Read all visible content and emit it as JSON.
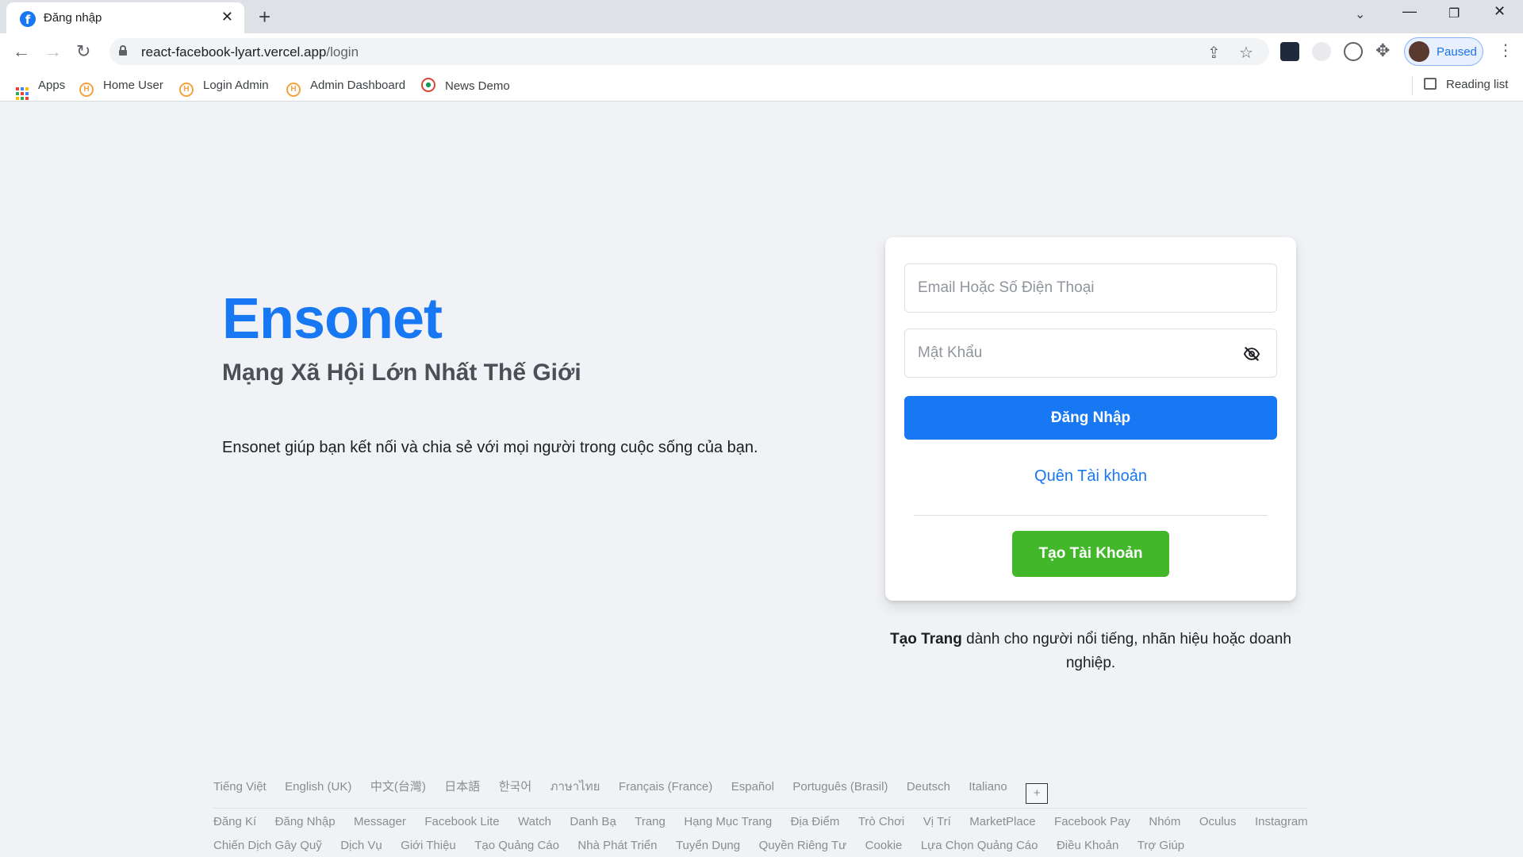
{
  "browser": {
    "tab_title": "Đăng nhập",
    "url_host": "react-facebook-lyart.vercel.app",
    "url_path": "/login",
    "profile_label": "Paused",
    "bookmarks": [
      {
        "label": "Apps",
        "icon": "apps-grid-icon"
      },
      {
        "label": "Home User",
        "icon": "h-site-icon"
      },
      {
        "label": "Login Admin",
        "icon": "h-site-icon"
      },
      {
        "label": "Admin Dashboard",
        "icon": "h-site-icon"
      },
      {
        "label": "News Demo",
        "icon": "news-icon"
      }
    ],
    "reading_list": "Reading list"
  },
  "login": {
    "brand": "Ensonet",
    "slogan": "Mạng Xã Hội Lớn Nhất Thế Giới",
    "intro": "Ensonet giúp bạn kết nối và chia sẻ với mọi người trong cuộc sống của bạn.",
    "email_placeholder": "Email Hoặc Số Điện Thoại",
    "password_placeholder": "Mật Khẩu",
    "login_button": "Đăng Nhập",
    "forgot_link": "Quên Tài khoản",
    "create_button": "Tạo Tài Khoản",
    "page_note_bold": "Tạo Trang",
    "page_note_rest": "dành cho người nổi tiếng, nhãn hiệu hoặc doanh nghiệp."
  },
  "footer": {
    "languages": [
      "Tiếng Việt",
      "English (UK)",
      "中文(台灣)",
      "日本語",
      "한국어",
      "ภาษาไทย",
      "Français (France)",
      "Español",
      "Português (Brasil)",
      "Deutsch",
      "Italiano"
    ],
    "more_languages": "+",
    "links_row1": [
      "Đăng Kí",
      "Đăng Nhập",
      "Messager",
      "Facebook Lite",
      "Watch",
      "Danh Bạ",
      "Trang",
      "Hạng Mục Trang",
      "Địa Điểm",
      "Trò Chơi",
      "Vị Trí",
      "MarketPlace",
      "Facebook Pay",
      "Nhóm",
      "Oculus",
      "Instagram"
    ],
    "links_row2": [
      "Chiến Dịch Gây Quỹ",
      "Dịch Vụ",
      "Giới Thiệu",
      "Tạo Quảng Cáo",
      "Nhà Phát Triển",
      "Tuyển Dụng",
      "Quyền Riêng Tư",
      "Cookie",
      "Lựa Chọn Quảng Cáo",
      "Điều Khoản",
      "Trợ Giúp"
    ]
  },
  "colors": {
    "brand_blue": "#1877f2",
    "create_green": "#42b72a",
    "page_bg": "#f0f2f5"
  }
}
